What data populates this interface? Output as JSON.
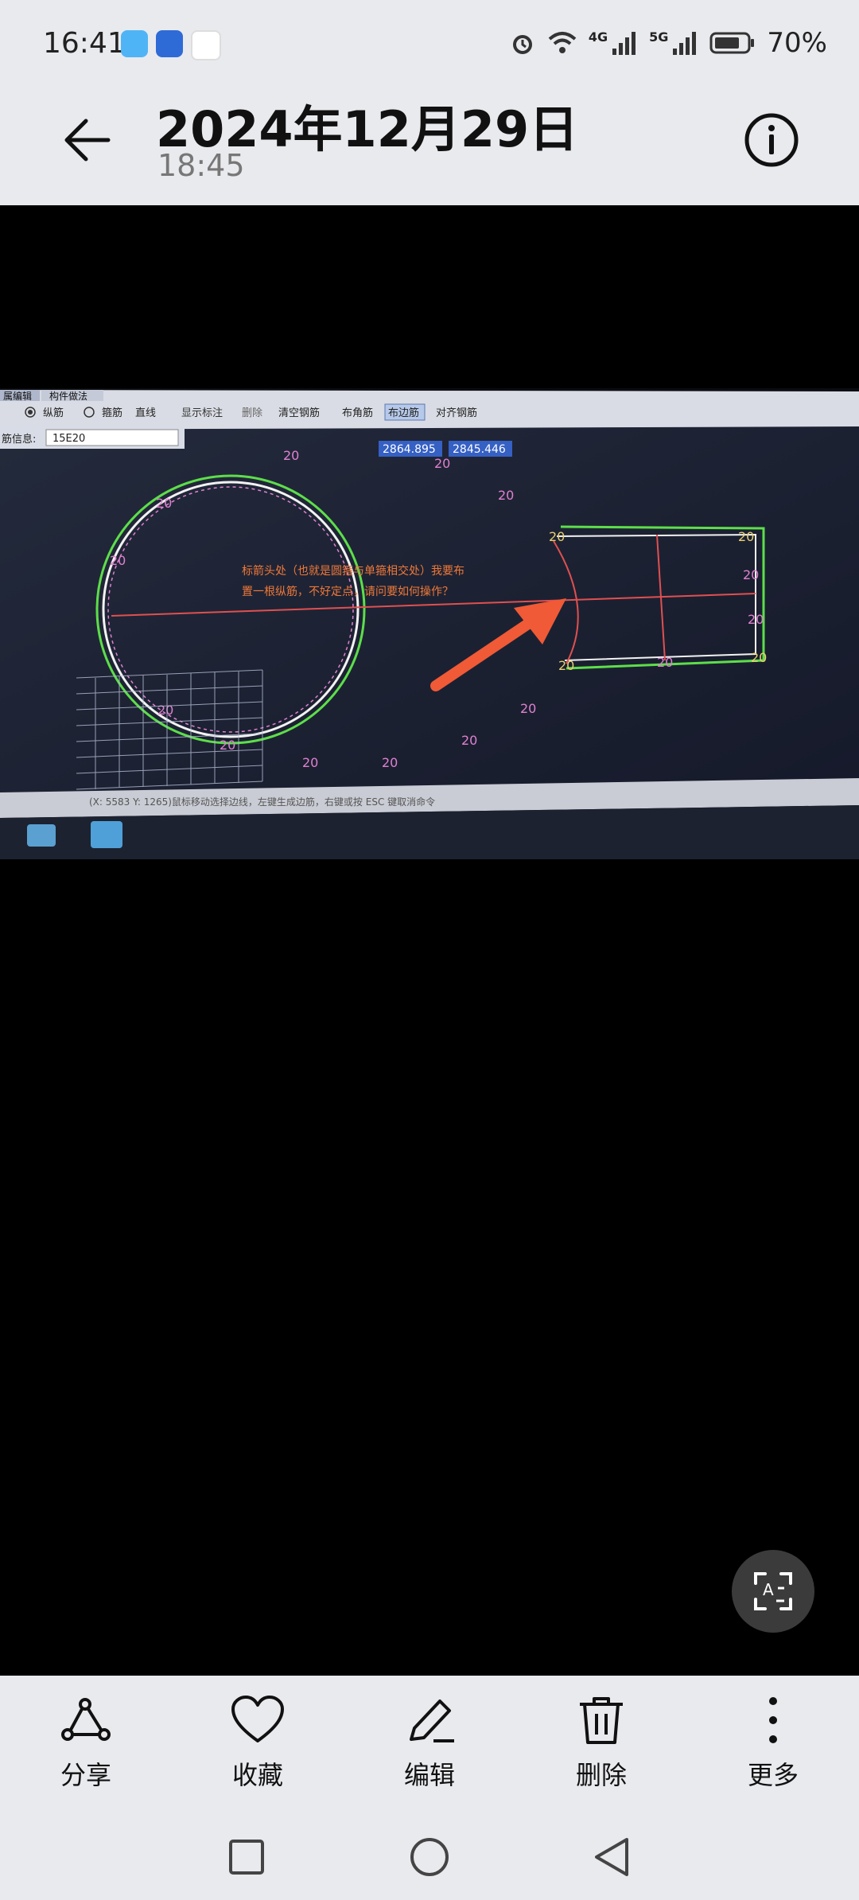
{
  "status_bar": {
    "time": "16:41",
    "network_4g": "4G",
    "network_5g": "5G",
    "battery": "70%"
  },
  "header": {
    "title": "2024年12月29日",
    "subtitle": "18:45"
  },
  "photo": {
    "tabs": [
      "属编辑",
      "构件做法"
    ],
    "toolbar_items": [
      "纵筋",
      "箍筋",
      "直线",
      "显示标注",
      "删除",
      "清空钢筋",
      "布角筋",
      "布边筋",
      "对齐钢筋"
    ],
    "info_label": "筋信息:",
    "info_value": "15E20",
    "dim_1": "2864.895",
    "dim_2": "2845.446",
    "note_line1": "标箭头处（也就是圆箍与单箍相交处）我要布",
    "note_line2": "置一根纵筋，不好定点，请问要如何操作？",
    "rebar_label": "20",
    "status_text": "(X: 5583 Y: 1265)鼠标移动选择边线，左键生成边筋，右键或按 ESC 键取消命令"
  },
  "toolbar": {
    "share": "分享",
    "favorite": "收藏",
    "edit": "编辑",
    "delete": "删除",
    "more": "更多"
  }
}
